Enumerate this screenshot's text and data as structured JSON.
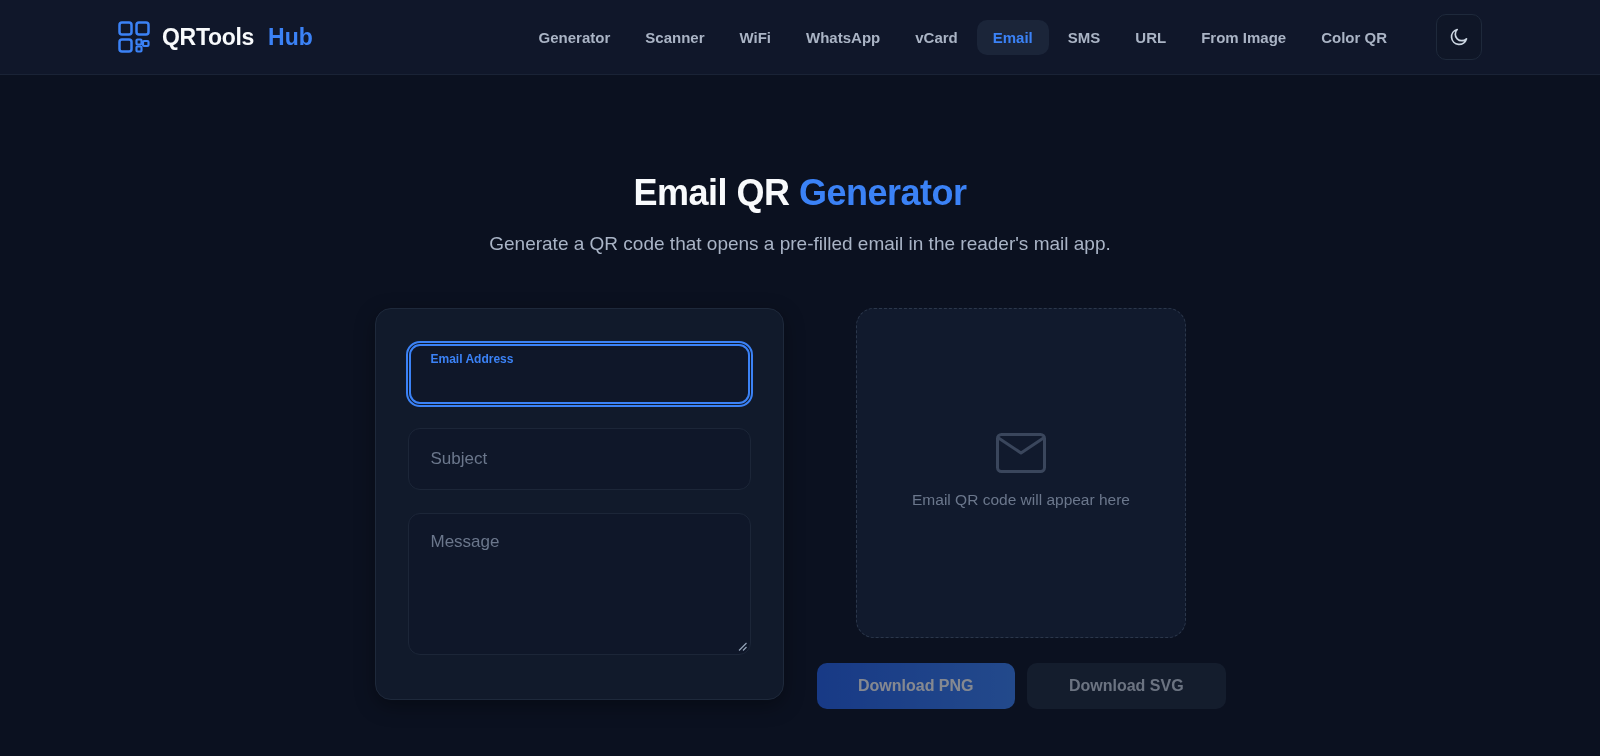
{
  "header": {
    "brand": {
      "name": "QRTools",
      "accent": "Hub"
    },
    "nav": [
      {
        "label": "Generator",
        "selected": false
      },
      {
        "label": "Scanner",
        "selected": false
      },
      {
        "label": "WiFi",
        "selected": false
      },
      {
        "label": "WhatsApp",
        "selected": false
      },
      {
        "label": "vCard",
        "selected": false
      },
      {
        "label": "Email",
        "selected": true
      },
      {
        "label": "SMS",
        "selected": false
      },
      {
        "label": "URL",
        "selected": false
      },
      {
        "label": "From Image",
        "selected": false
      },
      {
        "label": "Color QR",
        "selected": false
      }
    ]
  },
  "page": {
    "title": "Email QR",
    "title_accent": "Generator",
    "subtitle": "Generate a QR code that opens a pre-filled email in the reader's mail app."
  },
  "form": {
    "fields": [
      {
        "kind": "input",
        "label": "Email Address",
        "focused": true
      },
      {
        "kind": "input",
        "label": "Subject",
        "focused": false
      },
      {
        "kind": "textarea",
        "label": "Message",
        "focused": false
      }
    ]
  },
  "preview": {
    "placeholder": "Email QR code will appear here"
  },
  "actions": [
    {
      "kind": "primary",
      "label": "Download PNG",
      "disabled": true
    },
    {
      "kind": "secondary",
      "label": "Download SVG",
      "disabled": true
    }
  ]
}
